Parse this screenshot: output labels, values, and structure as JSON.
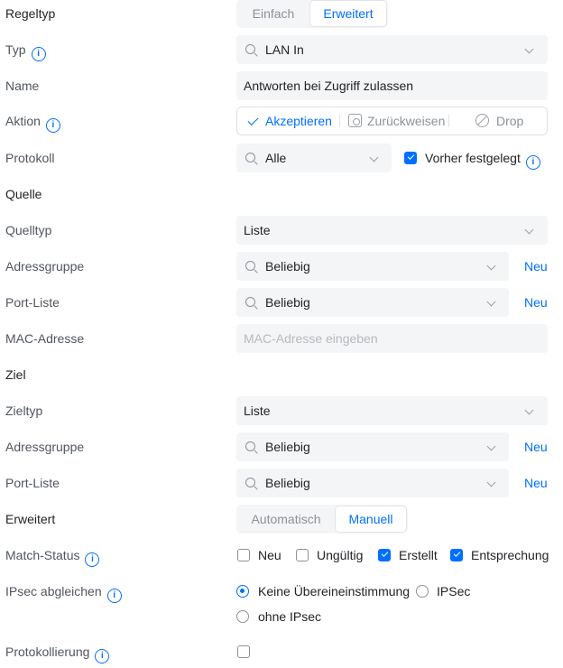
{
  "rule_type": {
    "label": "Regeltyp",
    "options": [
      "Einfach",
      "Erweitert"
    ],
    "selected": "Erweitert"
  },
  "type": {
    "label": "Typ",
    "value": "LAN In"
  },
  "name": {
    "label": "Name",
    "value": "Antworten bei Zugriff zulassen"
  },
  "action": {
    "label": "Aktion",
    "options": [
      "Akzeptieren",
      "Zurückweisen",
      "Drop"
    ],
    "selected": "Akzeptieren"
  },
  "protocol": {
    "label": "Protokoll",
    "value": "Alle",
    "predefined_label": "Vorher festgelegt",
    "predefined_checked": true
  },
  "source": {
    "heading": "Quelle",
    "type_label": "Quelltyp",
    "type_value": "Liste",
    "address_group_label": "Adressgruppe",
    "address_group_value": "Beliebig",
    "port_list_label": "Port-Liste",
    "port_list_value": "Beliebig",
    "mac_label": "MAC-Adresse",
    "mac_placeholder": "MAC-Adresse eingeben"
  },
  "destination": {
    "heading": "Ziel",
    "type_label": "Zieltyp",
    "type_value": "Liste",
    "address_group_label": "Adressgruppe",
    "address_group_value": "Beliebig",
    "port_list_label": "Port-Liste",
    "port_list_value": "Beliebig"
  },
  "new_link": "Neu",
  "advanced": {
    "label": "Erweitert",
    "options": [
      "Automatisch",
      "Manuell"
    ],
    "selected": "Manuell"
  },
  "match_status": {
    "label": "Match-Status",
    "options": [
      {
        "label": "Neu",
        "checked": false
      },
      {
        "label": "Ungültig",
        "checked": false
      },
      {
        "label": "Erstellt",
        "checked": true
      },
      {
        "label": "Entsprechung",
        "checked": true
      }
    ]
  },
  "ipsec": {
    "label": "IPsec abgleichen",
    "options": [
      "Keine Übereineinstimmung",
      "IPSec",
      "ohne IPsec"
    ],
    "selected": "Keine Übereineinstimmung"
  },
  "logging": {
    "label": "Protokollierung",
    "checked": false
  },
  "colors": {
    "accent": "#006fff",
    "field_bg": "#f4f5f6",
    "label": "#50565e",
    "text": "#212327"
  }
}
